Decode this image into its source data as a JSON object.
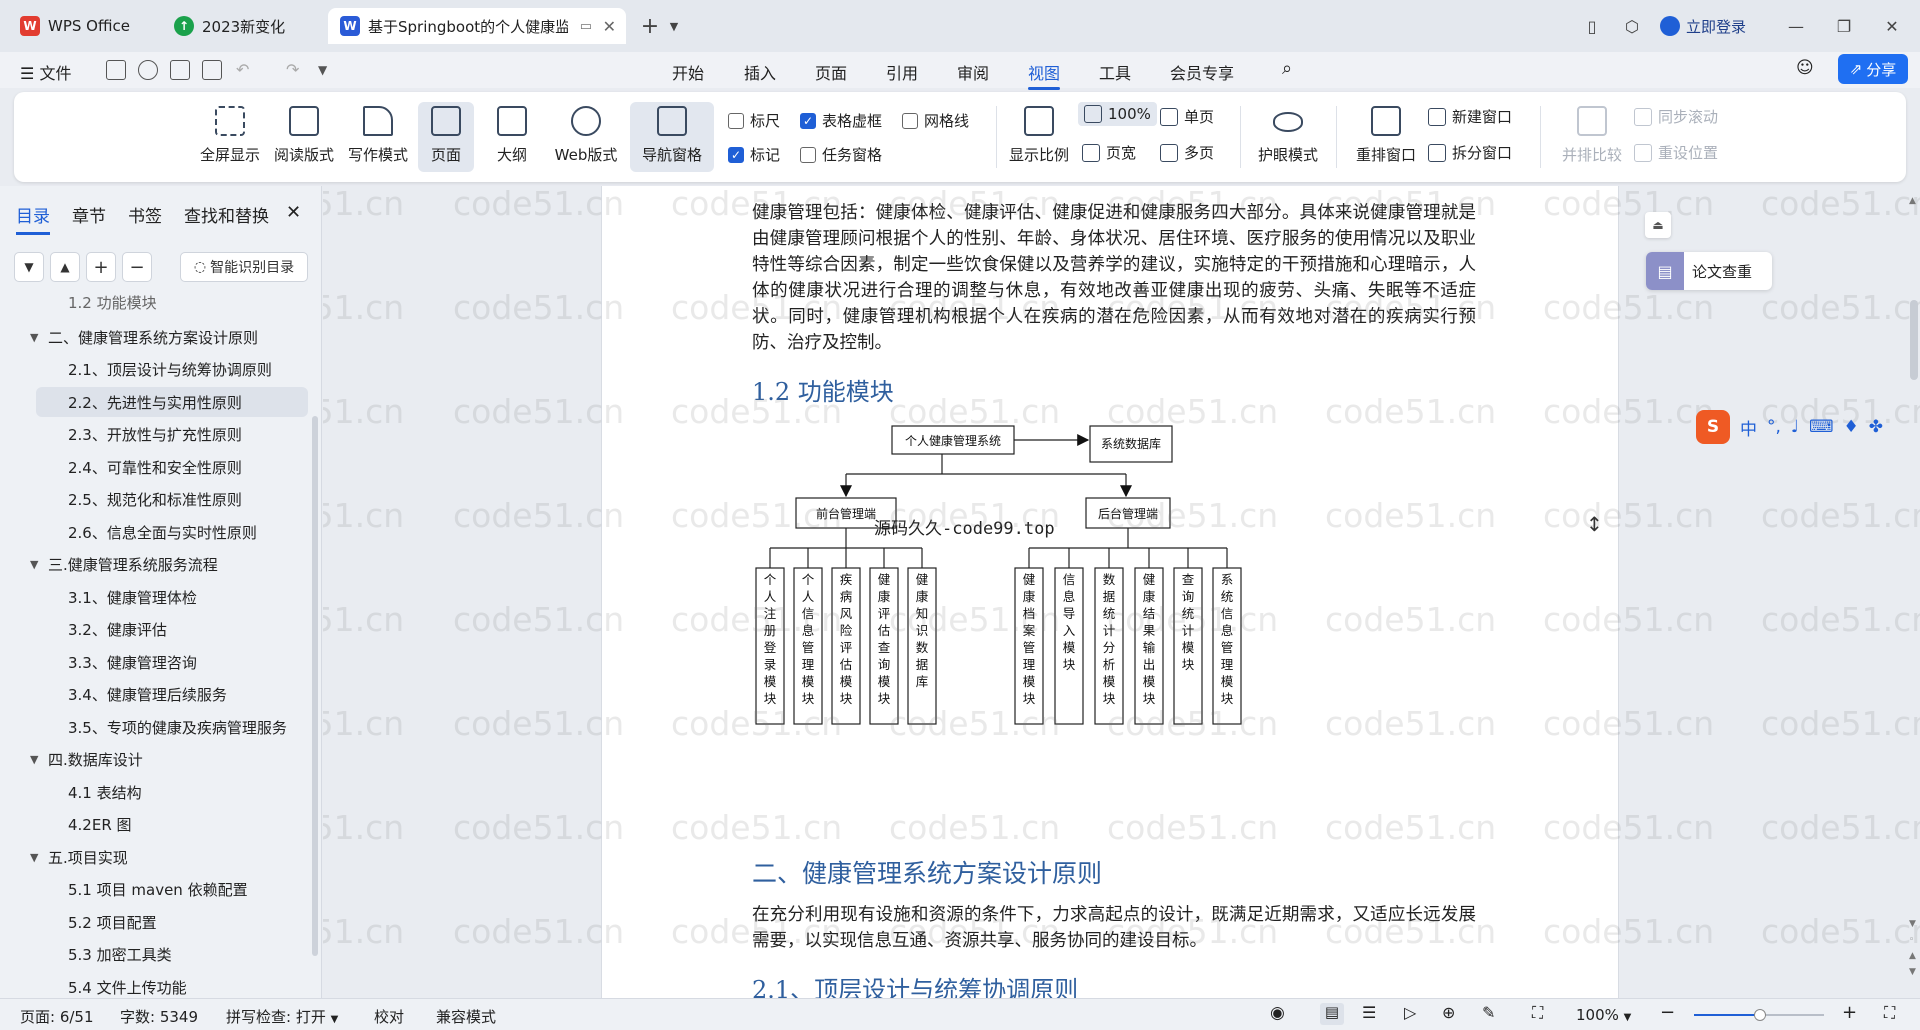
{
  "tabs": [
    {
      "label": "WPS Office",
      "icon": "wps-logo-icon",
      "color": "#e23c30"
    },
    {
      "label": "2023新变化",
      "icon": "upgrade-arrow-icon",
      "color": "#1aa14b"
    },
    {
      "label": "基于Springboot的个人健康监",
      "icon": "word-doc-icon",
      "color": "#2a5bd7"
    }
  ],
  "title_right": {
    "login": "立即登录"
  },
  "menu": {
    "file": "文件",
    "items": [
      "开始",
      "插入",
      "页面",
      "引用",
      "审阅",
      "视图",
      "工具",
      "会员专享"
    ],
    "active": "视图",
    "share": "分享"
  },
  "ribbon": {
    "view_modes": [
      "全屏显示",
      "阅读版式",
      "写作模式",
      "页面",
      "大纲",
      "Web版式"
    ],
    "selected_mode": "页面",
    "nav_pane": "导航窗格",
    "checks": [
      {
        "label": "标尺",
        "checked": false
      },
      {
        "label": "表格虚框",
        "checked": true
      },
      {
        "label": "网格线",
        "checked": false
      },
      {
        "label": "标记",
        "checked": true
      },
      {
        "label": "任务窗格",
        "checked": false
      }
    ],
    "zoom_ratio": "显示比例",
    "zoom_value": "100%",
    "single_page": "单页",
    "page_width": "页宽",
    "multi_page": "多页",
    "eye_mode": "护眼模式",
    "rearrange": "重排窗口",
    "new_window": "新建窗口",
    "split_window": "拆分窗口",
    "side_by_side": "并排比较",
    "sync_scroll": "同步滚动",
    "reset_pos": "重设位置"
  },
  "nav": {
    "tabs": [
      "目录",
      "章节",
      "书签",
      "查找和替换"
    ],
    "active_tab": "目录",
    "smart_toc": "智能识别目录",
    "toc": [
      {
        "label": "1.2 功能模块",
        "level": 2
      },
      {
        "label": "二、健康管理系统方案设计原则",
        "level": 1,
        "expanded": true
      },
      {
        "label": "2.1、顶层设计与统筹协调原则",
        "level": 2
      },
      {
        "label": "2.2、先进性与实用性原则",
        "level": 2,
        "selected": true
      },
      {
        "label": "2.3、开放性与扩充性原则",
        "level": 2
      },
      {
        "label": "2.4、可靠性和安全性原则",
        "level": 2
      },
      {
        "label": "2.5、规范化和标准性原则",
        "level": 2
      },
      {
        "label": "2.6、信息全面与实时性原则",
        "level": 2
      },
      {
        "label": "三.健康管理系统服务流程",
        "level": 1,
        "expanded": true
      },
      {
        "label": "3.1、健康管理体检",
        "level": 2
      },
      {
        "label": "3.2、健康评估",
        "level": 2
      },
      {
        "label": "3.3、健康管理咨询",
        "level": 2
      },
      {
        "label": "3.4、健康管理后续服务",
        "level": 2
      },
      {
        "label": "3.5、专项的健康及疾病管理服务",
        "level": 2
      },
      {
        "label": "四.数据库设计",
        "level": 1,
        "expanded": true
      },
      {
        "label": "4.1 表结构",
        "level": 2
      },
      {
        "label": "4.2ER 图",
        "level": 2
      },
      {
        "label": "五.项目实现",
        "level": 1,
        "expanded": true
      },
      {
        "label": "5.1 项目 maven 依赖配置",
        "level": 2
      },
      {
        "label": "5.2 项目配置",
        "level": 2
      },
      {
        "label": "5.3 加密工具类",
        "level": 2
      },
      {
        "label": "5.4 文件上传功能",
        "level": 2
      }
    ]
  },
  "document": {
    "para1": "健康管理包括：健康体检、健康评估、健康促进和健康服务四大部分。具体来说健康管理就是由健康管理顾问根据个人的性别、年龄、身体状况、居住环境、医疗服务的使用情况以及职业特性等综合因素，制定一些饮食保健以及营养学的建议，实施特定的干预措施和心理暗示，人体的健康状况进行合理的调整与休息，有效地改善亚健康出现的疲劳、头痛、失眠等不适症状。同时，健康管理机构根据个人在疾病的潜在危险因素，从而有效地对潜在的疾病实行预防、治疗及控制。",
    "h_func": "1.2 功能模块",
    "diagram": {
      "root": "个人健康管理系统",
      "db": "系统数据库",
      "front": "前台管理端",
      "back": "后台管理端",
      "front_modules": [
        "个人注册登录模块",
        "个人信息管理模块",
        "疾病风险评估模块",
        "健康评估查询模块",
        "健康知识数据库"
      ],
      "back_modules": [
        "健康档案管理模块",
        "信息导入模块",
        "数据统计分析模块",
        "健康结果输出模块",
        "查询统计模块",
        "系统信息管理模块"
      ]
    },
    "overlay": "源码久久-code99.top",
    "h_section2": "二、健康管理系统方案设计原则",
    "para2": "在充分利用现有设施和资源的条件下，力求高起点的设计，既满足近期需求，又适应长远发展需要，以实现信息互通、资源共享、服务协同的建设目标。",
    "h_21": "2.1、顶层设计与统筹协调原则",
    "watermark": "code51.cn"
  },
  "float_panel": {
    "lunwen": "论文查重"
  },
  "ime": {
    "label": "中"
  },
  "status": {
    "page": "页面: 6/51",
    "words": "字数: 5349",
    "spell": "拼写检查: 打开",
    "proof": "校对",
    "compat": "兼容模式",
    "zoom": "100%"
  }
}
